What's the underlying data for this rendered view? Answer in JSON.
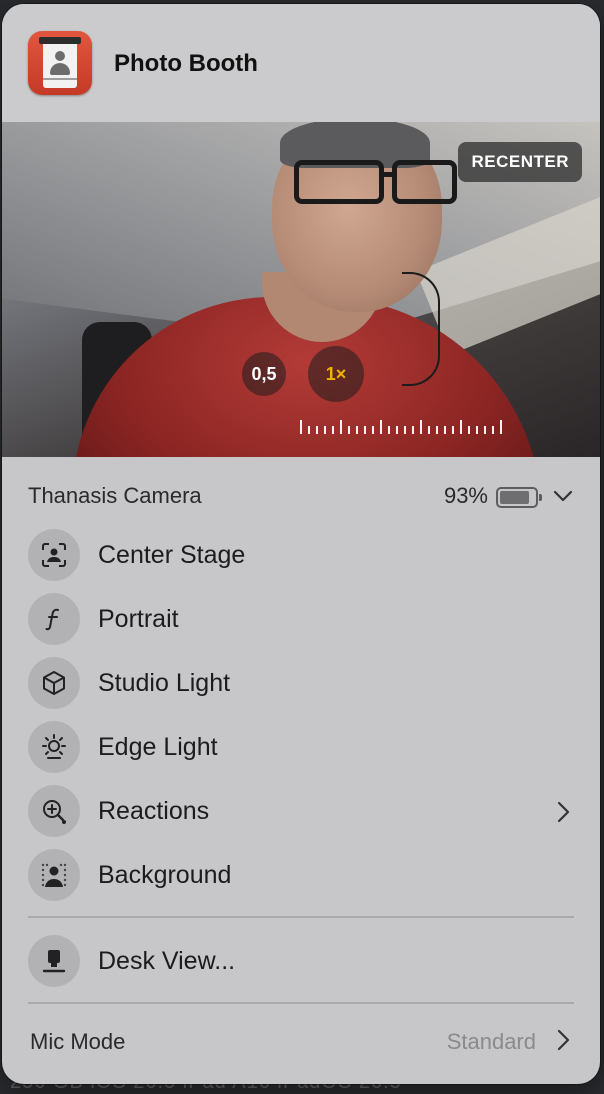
{
  "header": {
    "app_title": "Photo Booth",
    "app_icon": "photo-booth-icon"
  },
  "preview": {
    "recenter_label": "RECENTER",
    "zoom_options": [
      "0,5",
      "1×"
    ],
    "zoom_selected": "1×"
  },
  "device": {
    "name": "Thanasis Camera",
    "battery_percent": "93%",
    "battery_level": 0.93
  },
  "items": [
    {
      "label": "Center Stage",
      "icon": "center-stage-icon"
    },
    {
      "label": "Portrait",
      "icon": "portrait-f-icon"
    },
    {
      "label": "Studio Light",
      "icon": "cube-icon"
    },
    {
      "label": "Edge Light",
      "icon": "sun-light-icon"
    },
    {
      "label": "Reactions",
      "icon": "reactions-icon"
    },
    {
      "label": "Background",
      "icon": "background-person-icon"
    }
  ],
  "desk_view": {
    "label": "Desk View...",
    "icon": "desk-view-icon"
  },
  "mic": {
    "label": "Mic Mode",
    "value": "Standard"
  },
  "colors": {
    "panel": "#c7c7c9",
    "icon_circle": "#b2b2b4",
    "zoom_active": "#f0b400"
  }
}
